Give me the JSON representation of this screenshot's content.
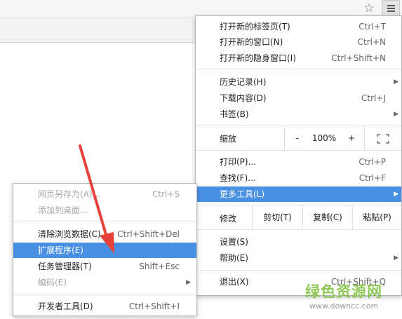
{
  "colors": {
    "highlight": "#4a90e2",
    "arrow": "#e8413c",
    "watermark_green": "#7dbf3a"
  },
  "toolbar": {
    "star_icon": "☆",
    "menu_icon": "hamburger-icon"
  },
  "main_menu": {
    "new_tab": {
      "label": "打开新的标签页(T)",
      "shortcut": "Ctrl+T"
    },
    "new_window": {
      "label": "打开新的窗口(N)",
      "shortcut": "Ctrl+N"
    },
    "new_incognito": {
      "label": "打开新的隐身窗口(I)",
      "shortcut": "Ctrl+Shift+N"
    },
    "history": {
      "label": "历史记录(H)"
    },
    "downloads": {
      "label": "下载内容(D)",
      "shortcut": "Ctrl+J"
    },
    "bookmarks": {
      "label": "书签(B)"
    },
    "zoom": {
      "label": "缩放",
      "minus": "-",
      "value": "100%",
      "plus": "+"
    },
    "print": {
      "label": "打印(P)...",
      "shortcut": "Ctrl+P"
    },
    "find": {
      "label": "查找(F)...",
      "shortcut": "Ctrl+F"
    },
    "more_tools": {
      "label": "更多工具(L)"
    },
    "edit": {
      "label": "修改",
      "cut": "剪切(T)",
      "copy": "复制(C)",
      "paste": "粘贴(P)"
    },
    "settings": {
      "label": "设置(S)"
    },
    "help": {
      "label": "帮助(E)"
    },
    "exit": {
      "label": "退出(X)",
      "shortcut": "Ctrl+Shift+Q"
    }
  },
  "sub_menu": {
    "save_as": {
      "label": "网页另存为(A)...",
      "shortcut": "Ctrl+S"
    },
    "add_desktop": {
      "label": "添加到桌面..."
    },
    "clear_data": {
      "label": "清除浏览数据(C)...",
      "shortcut": "Ctrl+Shift+Del"
    },
    "extensions": {
      "label": "扩展程序(E)"
    },
    "task_manager": {
      "label": "任务管理器(T)",
      "shortcut": "Shift+Esc"
    },
    "encoding": {
      "label": "编码(E)"
    },
    "dev_tools": {
      "label": "开发者工具(D)",
      "shortcut": "Ctrl+Shift+I"
    }
  },
  "watermark": {
    "logo": "绿色资源网",
    "url": "www.downcc.com"
  }
}
